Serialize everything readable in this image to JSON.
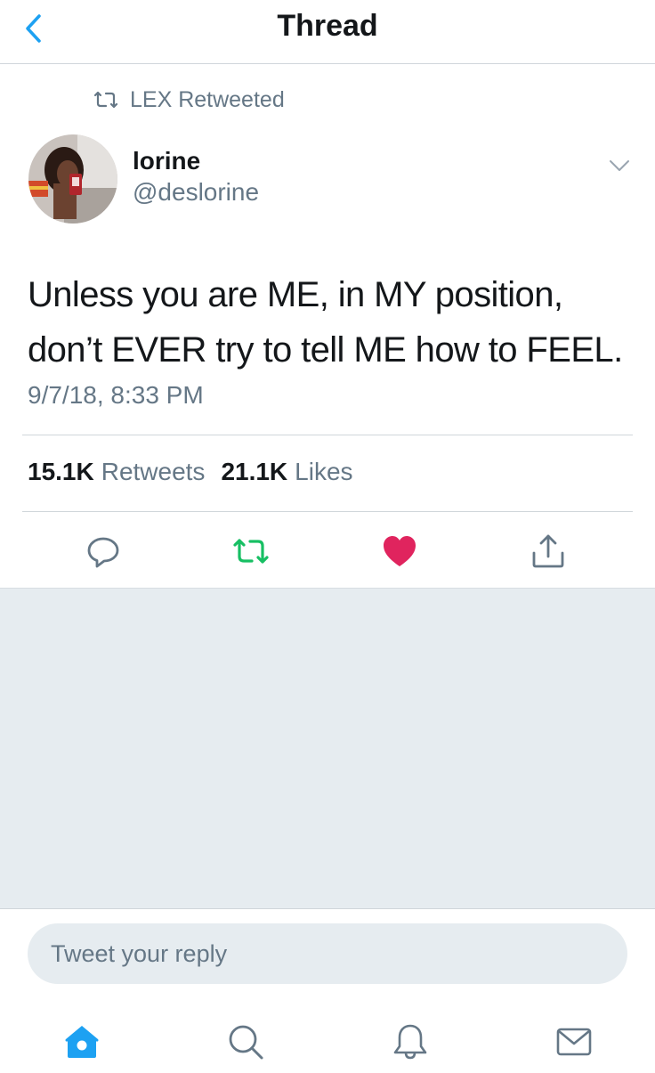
{
  "header": {
    "title": "Thread"
  },
  "retweet_banner": {
    "text": "LEX Retweeted"
  },
  "tweet": {
    "display_name": "lorine",
    "handle": "@deslorine",
    "text": "Unless you are ME, in MY position, don’t EVER try to tell ME how to FEEL.",
    "timestamp": "9/7/18, 8:33 PM",
    "retweets_count": "15.1K",
    "retweets_label": "Retweets",
    "likes_count": "21.1K",
    "likes_label": "Likes"
  },
  "reply": {
    "placeholder": "Tweet your reply"
  },
  "icons": {
    "back": "chevron-left-icon",
    "retweet": "retweet-icon",
    "caret": "chevron-down-icon",
    "reply": "reply-icon",
    "like": "heart-icon",
    "share": "share-icon",
    "home": "home-icon",
    "search": "search-icon",
    "notifications": "bell-icon",
    "messages": "mail-icon"
  },
  "colors": {
    "accent": "#1da1f2",
    "retweet_active": "#17bf63",
    "like_active": "#e0245e",
    "secondary_text": "#657786",
    "background_gray": "#e6ecf0"
  }
}
